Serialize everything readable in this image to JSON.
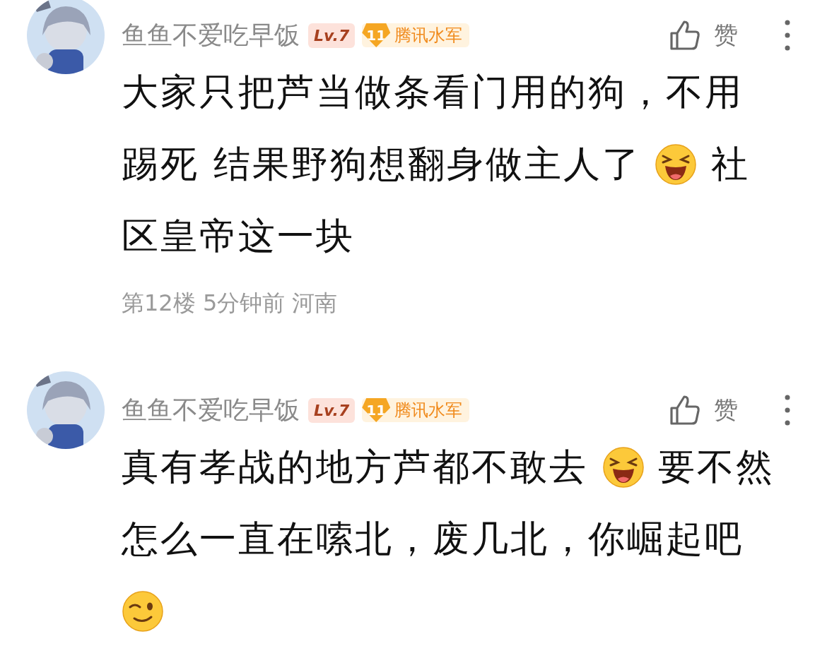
{
  "comments": [
    {
      "user": {
        "name": "鱼鱼不爱吃早饭",
        "level": "Lv.7",
        "rank": "11",
        "title": "腾讯水军"
      },
      "like_label": "赞",
      "lines": [
        [
          {
            "kind": "text",
            "text": "大家只把芦当做条看门用的狗，不用"
          }
        ],
        [
          {
            "kind": "text",
            "text": "踢死 结果野狗想翻身做主人了 "
          },
          {
            "kind": "laugh"
          },
          {
            "kind": "text",
            "text": " 社"
          }
        ],
        [
          {
            "kind": "text",
            "text": "区皇帝这一块"
          }
        ]
      ],
      "meta": "第12楼 5分钟前 河南"
    },
    {
      "user": {
        "name": "鱼鱼不爱吃早饭",
        "level": "Lv.7",
        "rank": "11",
        "title": "腾讯水军"
      },
      "like_label": "赞",
      "lines": [
        [
          {
            "kind": "text",
            "text": "真有孝战的地方芦都不敢去 "
          },
          {
            "kind": "laugh"
          },
          {
            "kind": "text",
            "text": " 要不然"
          }
        ],
        [
          {
            "kind": "text",
            "text": "怎么一直在嗦北，废几北，你崛起吧"
          }
        ],
        [
          {
            "kind": "wink"
          }
        ]
      ]
    }
  ]
}
